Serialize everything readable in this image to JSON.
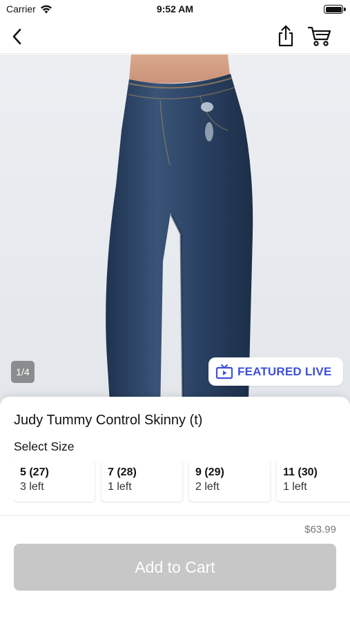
{
  "status_bar": {
    "carrier": "Carrier",
    "time": "9:52 AM",
    "battery_level": 1.0,
    "wifi_icon": "wifi-icon"
  },
  "nav": {
    "back_icon": "chevron-left-icon",
    "share_icon": "share-icon",
    "cart_icon": "cart-icon"
  },
  "product_image": {
    "counter": "1/4",
    "featured_live_label": "FEATURED LIVE",
    "featured_live_icon": "tv-play-icon",
    "accent_color": "#3d4fd9"
  },
  "product": {
    "title": "Judy Tummy Control Skinny (t)",
    "size_heading": "Select Size",
    "sizes": [
      {
        "label": "5 (27)",
        "stock": "3 left"
      },
      {
        "label": "7 (28)",
        "stock": "1 left"
      },
      {
        "label": "9 (29)",
        "stock": "2 left"
      },
      {
        "label": "11 (30)",
        "stock": "1 left"
      }
    ],
    "price": "$63.99",
    "add_to_cart_label": "Add to Cart",
    "add_to_cart_color": "#c7c7c7"
  }
}
